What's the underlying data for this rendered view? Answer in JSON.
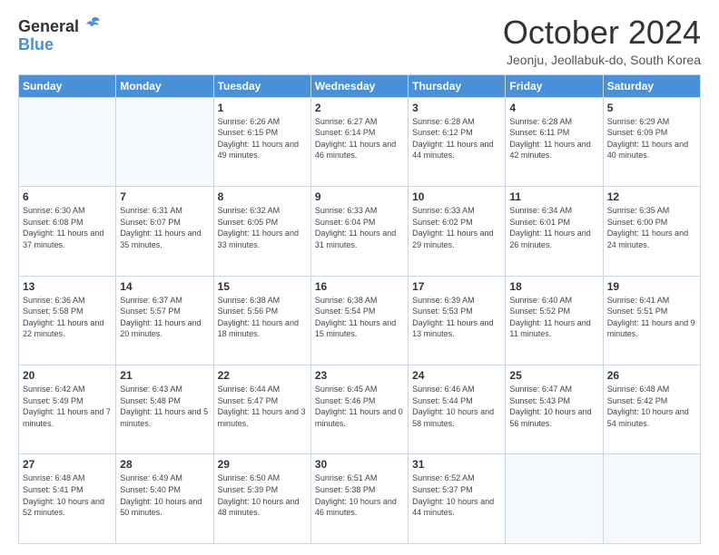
{
  "header": {
    "logo_general": "General",
    "logo_blue": "Blue",
    "month_title": "October 2024",
    "subtitle": "Jeonju, Jeollabuk-do, South Korea"
  },
  "weekdays": [
    "Sunday",
    "Monday",
    "Tuesday",
    "Wednesday",
    "Thursday",
    "Friday",
    "Saturday"
  ],
  "weeks": [
    [
      {
        "day": "",
        "sunrise": "",
        "sunset": "",
        "daylight": ""
      },
      {
        "day": "",
        "sunrise": "",
        "sunset": "",
        "daylight": ""
      },
      {
        "day": "1",
        "sunrise": "Sunrise: 6:26 AM",
        "sunset": "Sunset: 6:15 PM",
        "daylight": "Daylight: 11 hours and 49 minutes."
      },
      {
        "day": "2",
        "sunrise": "Sunrise: 6:27 AM",
        "sunset": "Sunset: 6:14 PM",
        "daylight": "Daylight: 11 hours and 46 minutes."
      },
      {
        "day": "3",
        "sunrise": "Sunrise: 6:28 AM",
        "sunset": "Sunset: 6:12 PM",
        "daylight": "Daylight: 11 hours and 44 minutes."
      },
      {
        "day": "4",
        "sunrise": "Sunrise: 6:28 AM",
        "sunset": "Sunset: 6:11 PM",
        "daylight": "Daylight: 11 hours and 42 minutes."
      },
      {
        "day": "5",
        "sunrise": "Sunrise: 6:29 AM",
        "sunset": "Sunset: 6:09 PM",
        "daylight": "Daylight: 11 hours and 40 minutes."
      }
    ],
    [
      {
        "day": "6",
        "sunrise": "Sunrise: 6:30 AM",
        "sunset": "Sunset: 6:08 PM",
        "daylight": "Daylight: 11 hours and 37 minutes."
      },
      {
        "day": "7",
        "sunrise": "Sunrise: 6:31 AM",
        "sunset": "Sunset: 6:07 PM",
        "daylight": "Daylight: 11 hours and 35 minutes."
      },
      {
        "day": "8",
        "sunrise": "Sunrise: 6:32 AM",
        "sunset": "Sunset: 6:05 PM",
        "daylight": "Daylight: 11 hours and 33 minutes."
      },
      {
        "day": "9",
        "sunrise": "Sunrise: 6:33 AM",
        "sunset": "Sunset: 6:04 PM",
        "daylight": "Daylight: 11 hours and 31 minutes."
      },
      {
        "day": "10",
        "sunrise": "Sunrise: 6:33 AM",
        "sunset": "Sunset: 6:02 PM",
        "daylight": "Daylight: 11 hours and 29 minutes."
      },
      {
        "day": "11",
        "sunrise": "Sunrise: 6:34 AM",
        "sunset": "Sunset: 6:01 PM",
        "daylight": "Daylight: 11 hours and 26 minutes."
      },
      {
        "day": "12",
        "sunrise": "Sunrise: 6:35 AM",
        "sunset": "Sunset: 6:00 PM",
        "daylight": "Daylight: 11 hours and 24 minutes."
      }
    ],
    [
      {
        "day": "13",
        "sunrise": "Sunrise: 6:36 AM",
        "sunset": "Sunset: 5:58 PM",
        "daylight": "Daylight: 11 hours and 22 minutes."
      },
      {
        "day": "14",
        "sunrise": "Sunrise: 6:37 AM",
        "sunset": "Sunset: 5:57 PM",
        "daylight": "Daylight: 11 hours and 20 minutes."
      },
      {
        "day": "15",
        "sunrise": "Sunrise: 6:38 AM",
        "sunset": "Sunset: 5:56 PM",
        "daylight": "Daylight: 11 hours and 18 minutes."
      },
      {
        "day": "16",
        "sunrise": "Sunrise: 6:38 AM",
        "sunset": "Sunset: 5:54 PM",
        "daylight": "Daylight: 11 hours and 15 minutes."
      },
      {
        "day": "17",
        "sunrise": "Sunrise: 6:39 AM",
        "sunset": "Sunset: 5:53 PM",
        "daylight": "Daylight: 11 hours and 13 minutes."
      },
      {
        "day": "18",
        "sunrise": "Sunrise: 6:40 AM",
        "sunset": "Sunset: 5:52 PM",
        "daylight": "Daylight: 11 hours and 11 minutes."
      },
      {
        "day": "19",
        "sunrise": "Sunrise: 6:41 AM",
        "sunset": "Sunset: 5:51 PM",
        "daylight": "Daylight: 11 hours and 9 minutes."
      }
    ],
    [
      {
        "day": "20",
        "sunrise": "Sunrise: 6:42 AM",
        "sunset": "Sunset: 5:49 PM",
        "daylight": "Daylight: 11 hours and 7 minutes."
      },
      {
        "day": "21",
        "sunrise": "Sunrise: 6:43 AM",
        "sunset": "Sunset: 5:48 PM",
        "daylight": "Daylight: 11 hours and 5 minutes."
      },
      {
        "day": "22",
        "sunrise": "Sunrise: 6:44 AM",
        "sunset": "Sunset: 5:47 PM",
        "daylight": "Daylight: 11 hours and 3 minutes."
      },
      {
        "day": "23",
        "sunrise": "Sunrise: 6:45 AM",
        "sunset": "Sunset: 5:46 PM",
        "daylight": "Daylight: 11 hours and 0 minutes."
      },
      {
        "day": "24",
        "sunrise": "Sunrise: 6:46 AM",
        "sunset": "Sunset: 5:44 PM",
        "daylight": "Daylight: 10 hours and 58 minutes."
      },
      {
        "day": "25",
        "sunrise": "Sunrise: 6:47 AM",
        "sunset": "Sunset: 5:43 PM",
        "daylight": "Daylight: 10 hours and 56 minutes."
      },
      {
        "day": "26",
        "sunrise": "Sunrise: 6:48 AM",
        "sunset": "Sunset: 5:42 PM",
        "daylight": "Daylight: 10 hours and 54 minutes."
      }
    ],
    [
      {
        "day": "27",
        "sunrise": "Sunrise: 6:48 AM",
        "sunset": "Sunset: 5:41 PM",
        "daylight": "Daylight: 10 hours and 52 minutes."
      },
      {
        "day": "28",
        "sunrise": "Sunrise: 6:49 AM",
        "sunset": "Sunset: 5:40 PM",
        "daylight": "Daylight: 10 hours and 50 minutes."
      },
      {
        "day": "29",
        "sunrise": "Sunrise: 6:50 AM",
        "sunset": "Sunset: 5:39 PM",
        "daylight": "Daylight: 10 hours and 48 minutes."
      },
      {
        "day": "30",
        "sunrise": "Sunrise: 6:51 AM",
        "sunset": "Sunset: 5:38 PM",
        "daylight": "Daylight: 10 hours and 46 minutes."
      },
      {
        "day": "31",
        "sunrise": "Sunrise: 6:52 AM",
        "sunset": "Sunset: 5:37 PM",
        "daylight": "Daylight: 10 hours and 44 minutes."
      },
      {
        "day": "",
        "sunrise": "",
        "sunset": "",
        "daylight": ""
      },
      {
        "day": "",
        "sunrise": "",
        "sunset": "",
        "daylight": ""
      }
    ]
  ]
}
